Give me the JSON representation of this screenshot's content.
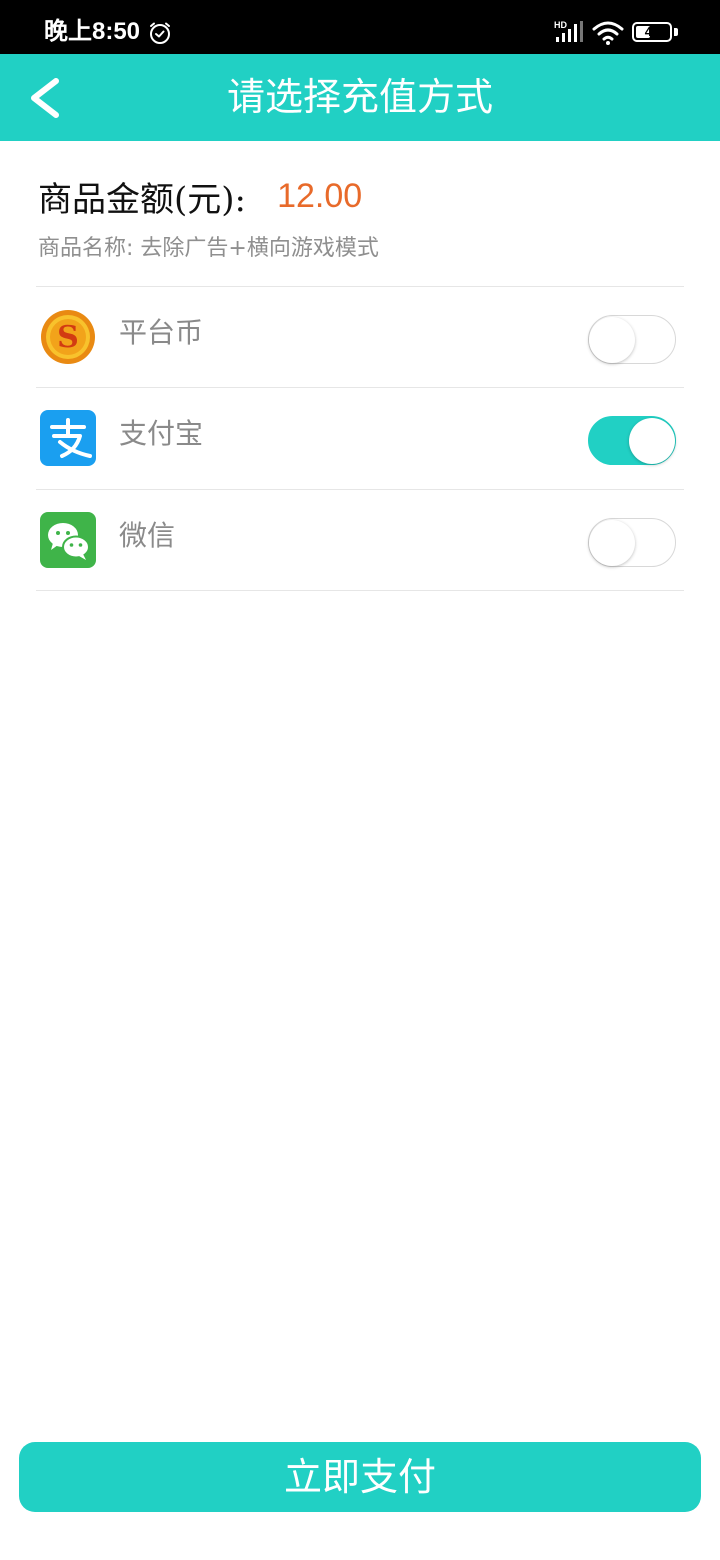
{
  "status_bar": {
    "time": "晚上8:50",
    "network_badge": "HD",
    "battery_level": "44",
    "battery_fraction": 0.44
  },
  "header": {
    "title": "请选择充值方式"
  },
  "product": {
    "amount_label": "商品金额(元):",
    "amount_value": "12.00",
    "name_text": "商品名称: 去除广告+横向游戏模式"
  },
  "payment_options": [
    {
      "label": "平台币",
      "icon": "coin-icon",
      "selected": false
    },
    {
      "label": "支付宝",
      "icon": "alipay-icon",
      "selected": true
    },
    {
      "label": "微信",
      "icon": "wechat-icon",
      "selected": false
    }
  ],
  "pay_button": {
    "label": "立即支付"
  },
  "colors": {
    "accent": "#21d0c4",
    "price": "#e86a2a",
    "alipay": "#1a9ff0",
    "wechat": "#3fb449"
  }
}
